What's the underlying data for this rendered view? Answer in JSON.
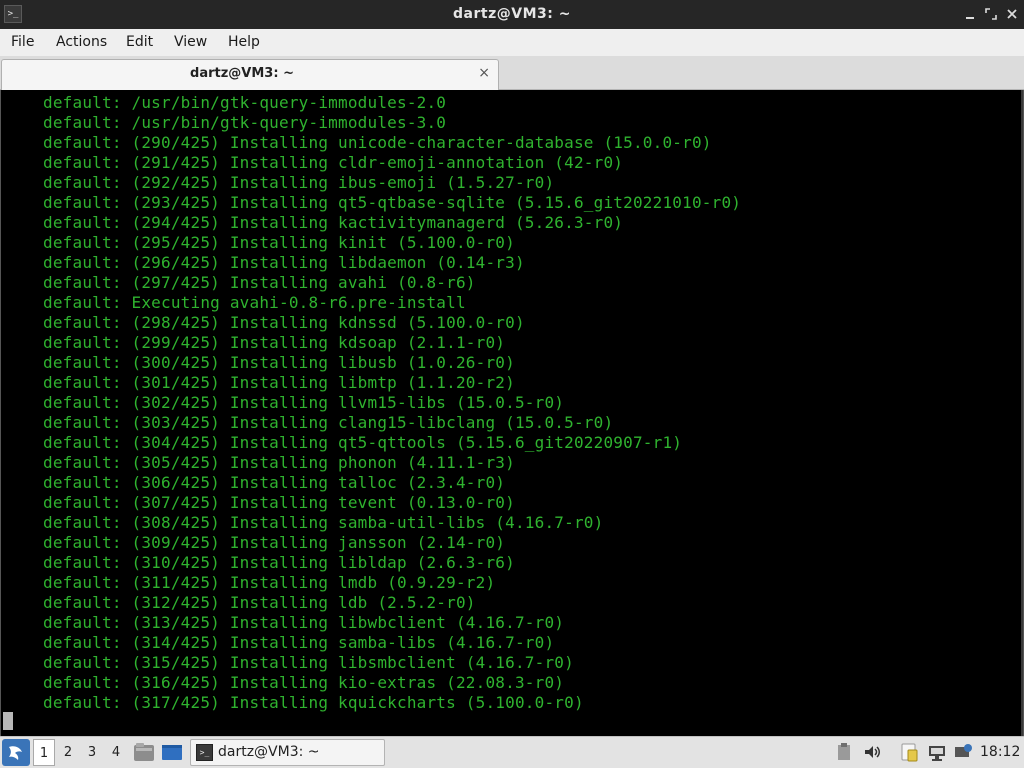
{
  "window": {
    "title": "dartz@VM3: ~",
    "app_icon": "terminal-icon",
    "controls": [
      "minimize",
      "maximize",
      "close"
    ]
  },
  "menu": {
    "items": [
      "File",
      "Actions",
      "Edit",
      "View",
      "Help"
    ]
  },
  "tab": {
    "label": "dartz@VM3: ~",
    "close_glyph": "×"
  },
  "terminal": {
    "lines": [
      "default: /usr/bin/gtk-query-immodules-2.0",
      "default: /usr/bin/gtk-query-immodules-3.0",
      "default: (290/425) Installing unicode-character-database (15.0.0-r0)",
      "default: (291/425) Installing cldr-emoji-annotation (42-r0)",
      "default: (292/425) Installing ibus-emoji (1.5.27-r0)",
      "default: (293/425) Installing qt5-qtbase-sqlite (5.15.6_git20221010-r0)",
      "default: (294/425) Installing kactivitymanagerd (5.26.3-r0)",
      "default: (295/425) Installing kinit (5.100.0-r0)",
      "default: (296/425) Installing libdaemon (0.14-r3)",
      "default: (297/425) Installing avahi (0.8-r6)",
      "default: Executing avahi-0.8-r6.pre-install",
      "default: (298/425) Installing kdnssd (5.100.0-r0)",
      "default: (299/425) Installing kdsoap (2.1.1-r0)",
      "default: (300/425) Installing libusb (1.0.26-r0)",
      "default: (301/425) Installing libmtp (1.1.20-r2)",
      "default: (302/425) Installing llvm15-libs (15.0.5-r0)",
      "default: (303/425) Installing clang15-libclang (15.0.5-r0)",
      "default: (304/425) Installing qt5-qttools (5.15.6_git20220907-r1)",
      "default: (305/425) Installing phonon (4.11.1-r3)",
      "default: (306/425) Installing talloc (2.3.4-r0)",
      "default: (307/425) Installing tevent (0.13.0-r0)",
      "default: (308/425) Installing samba-util-libs (4.16.7-r0)",
      "default: (309/425) Installing jansson (2.14-r0)",
      "default: (310/425) Installing libldap (2.6.3-r6)",
      "default: (311/425) Installing lmdb (0.9.29-r2)",
      "default: (312/425) Installing ldb (2.5.2-r0)",
      "default: (313/425) Installing libwbclient (4.16.7-r0)",
      "default: (314/425) Installing samba-libs (4.16.7-r0)",
      "default: (315/425) Installing libsmbclient (4.16.7-r0)",
      "default: (316/425) Installing kio-extras (22.08.3-r0)",
      "default: (317/425) Installing kquickcharts (5.100.0-r0)"
    ],
    "text_color": "#2fb32f",
    "background": "#000000"
  },
  "taskbar": {
    "workspaces": [
      "1",
      "2",
      "3",
      "4"
    ],
    "active_workspace": "1",
    "task_label": "dartz@VM3: ~",
    "clock": "18:12",
    "tray_icons": [
      "clipboard-icon",
      "volume-icon",
      "notes-icon",
      "network-icon",
      "update-icon"
    ]
  },
  "colors": {
    "titlebar": "#262626",
    "menubar": "#efefef",
    "taskbar": "#e3e3e3",
    "accent": "#3a74b8"
  }
}
